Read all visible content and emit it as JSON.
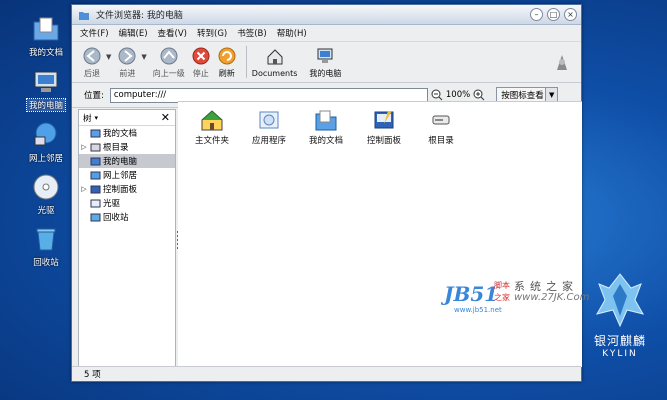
{
  "desktop": {
    "icons": [
      {
        "label": "我的文档"
      },
      {
        "label": "我的电脑"
      },
      {
        "label": "网上邻居"
      },
      {
        "label": "光驱"
      },
      {
        "label": "回收站"
      }
    ]
  },
  "window": {
    "title": "文件浏览器: 我的电脑",
    "menu": [
      "文件(F)",
      "编辑(E)",
      "查看(V)",
      "转到(G)",
      "书签(B)",
      "帮助(H)"
    ],
    "toolbar": {
      "back": "后退",
      "forward": "前进",
      "up": "向上一级",
      "stop": "停止",
      "refresh": "刷新",
      "documents": "Documents",
      "computer": "我的电脑"
    },
    "location": {
      "label": "位置:",
      "value": "computer:///",
      "zoom": "100%",
      "view_mode": "按图标查看"
    },
    "sidebar": {
      "header": "树",
      "items": [
        {
          "label": "我的文档",
          "expandable": false,
          "selected": false
        },
        {
          "label": "根目录",
          "expandable": true,
          "selected": false
        },
        {
          "label": "我的电脑",
          "expandable": false,
          "selected": true
        },
        {
          "label": "网上邻居",
          "expandable": false,
          "selected": false
        },
        {
          "label": "控制面板",
          "expandable": true,
          "selected": false
        },
        {
          "label": "光驱",
          "expandable": false,
          "selected": false
        },
        {
          "label": "回收站",
          "expandable": false,
          "selected": false
        }
      ]
    },
    "files": [
      {
        "label": "主文件夹"
      },
      {
        "label": "应用程序"
      },
      {
        "label": "我的文档"
      },
      {
        "label": "控制面板"
      },
      {
        "label": "根目录"
      }
    ],
    "status": "5 项"
  },
  "watermark": {
    "brand": "JB51",
    "cn_top": "脚本",
    "cn_bottom": "之家",
    "slogan": "系统之家",
    "url": "www.27JK.Com",
    "url_small": "www.jb51.net"
  },
  "kylin": {
    "name": "银河麒麟",
    "en": "KYLIN"
  }
}
